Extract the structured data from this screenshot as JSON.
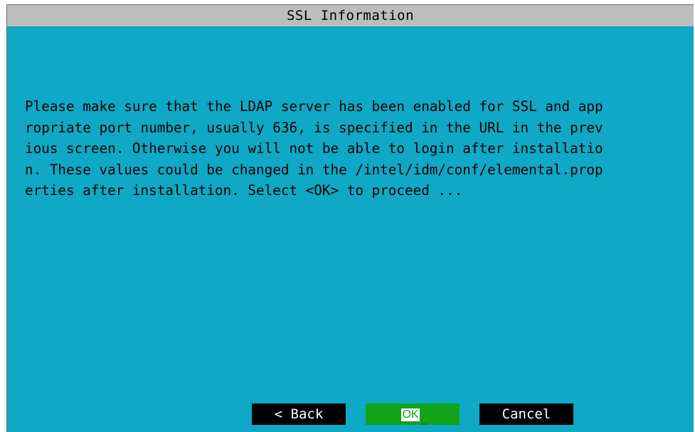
{
  "dialog": {
    "title": "SSL Information",
    "message_lines": [
      "Please make sure that the LDAP server has been enabled for SSL and app",
      "ropriate port number, usually 636, is specified in the URL in the prev",
      "ious screen. Otherwise you will not be able to login after installatio",
      "n. These values could be changed in the /intel/idm/conf/elemental.prop",
      "erties after installation. Select <OK> to proceed ..."
    ],
    "buttons": {
      "back": "< Back",
      "ok": "OK",
      "cancel": "Cancel"
    },
    "selected_button": "ok"
  },
  "colors": {
    "background": "#0fa8c6",
    "title_bar": "#bdbdbd",
    "button": "#000000",
    "selected_button": "#11a31a"
  }
}
